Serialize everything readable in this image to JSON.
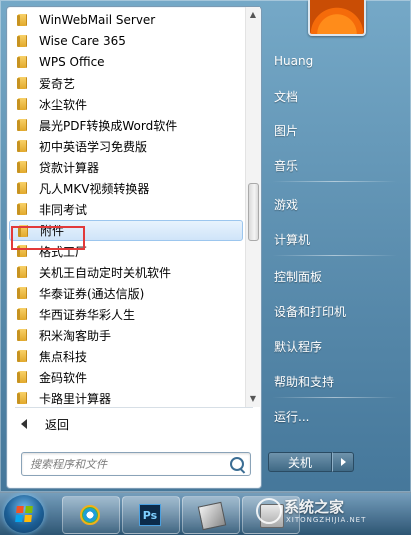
{
  "start_menu": {
    "programs": [
      {
        "label": "WinWebMail Server"
      },
      {
        "label": "Wise Care 365"
      },
      {
        "label": "WPS Office"
      },
      {
        "label": "爱奇艺"
      },
      {
        "label": "冰尘软件"
      },
      {
        "label": "晨光PDF转换成Word软件"
      },
      {
        "label": "初中英语学习免费版"
      },
      {
        "label": "贷款计算器"
      },
      {
        "label": "凡人MKV视频转换器"
      },
      {
        "label": "非同考试"
      },
      {
        "label": "附件",
        "selected": true,
        "highlighted": true
      },
      {
        "label": "格式工厂"
      },
      {
        "label": "关机王自动定时关机软件"
      },
      {
        "label": "华泰证券(通达信版)"
      },
      {
        "label": "华西证券华彩人生"
      },
      {
        "label": "积米淘客助手"
      },
      {
        "label": "焦点科技"
      },
      {
        "label": "金码软件"
      },
      {
        "label": "卡路里计算器"
      }
    ],
    "back_label": "返回",
    "search_placeholder": "搜索程序和文件",
    "right_items": [
      {
        "label": "Huang"
      },
      {
        "label": "文档"
      },
      {
        "label": "图片"
      },
      {
        "label": "音乐"
      },
      {
        "label": "游戏"
      },
      {
        "label": "计算机"
      },
      {
        "label": "控制面板"
      },
      {
        "label": "设备和打印机"
      },
      {
        "label": "默认程序"
      },
      {
        "label": "帮助和支持"
      },
      {
        "label": "运行..."
      }
    ],
    "shutdown_label": "关机"
  },
  "taskbar": {
    "buttons": [
      {
        "icon": "start-orb-icon"
      },
      {
        "icon": "internet-explorer-icon"
      },
      {
        "icon": "photoshop-icon",
        "text": "Ps"
      },
      {
        "icon": "app-icon"
      },
      {
        "icon": "app-icon"
      }
    ]
  },
  "watermark": {
    "title": "系统之家",
    "url": "XITONGZHIJIA.NET"
  },
  "colors": {
    "selection_border": "#9cc6ee",
    "highlight_box": "#e23a3a",
    "menu_bg_top": "#78aac8",
    "menu_bg_bottom": "#46789b"
  }
}
